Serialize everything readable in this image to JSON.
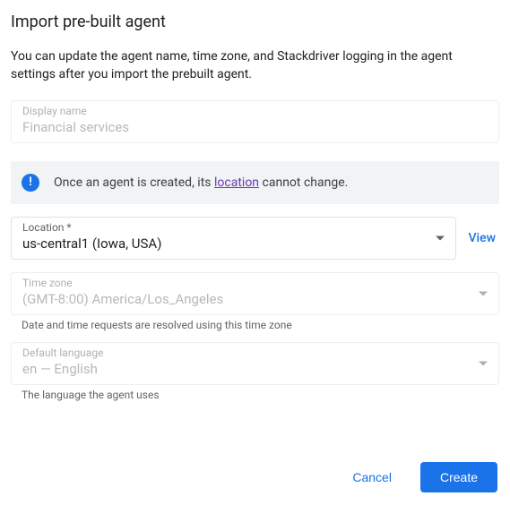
{
  "title": "Import pre-built agent",
  "subtitle": "You can update the agent name, time zone, and Stackdriver logging in the agent settings after you import the prebuilt agent.",
  "displayName": {
    "label": "Display name",
    "placeholder": "Financial services"
  },
  "info": {
    "pre": "Once an agent is created, its ",
    "link": "location",
    "post": " cannot change."
  },
  "location": {
    "label": "Location *",
    "value": "us-central1 (Iowa, USA)",
    "viewLabel": "View"
  },
  "timezone": {
    "label": "Time zone",
    "value": "(GMT-8:00) America/Los_Angeles",
    "helper": "Date and time requests are resolved using this time zone"
  },
  "language": {
    "label": "Default language",
    "value": "en — English",
    "helper": "The language the agent uses"
  },
  "actions": {
    "cancel": "Cancel",
    "create": "Create"
  }
}
